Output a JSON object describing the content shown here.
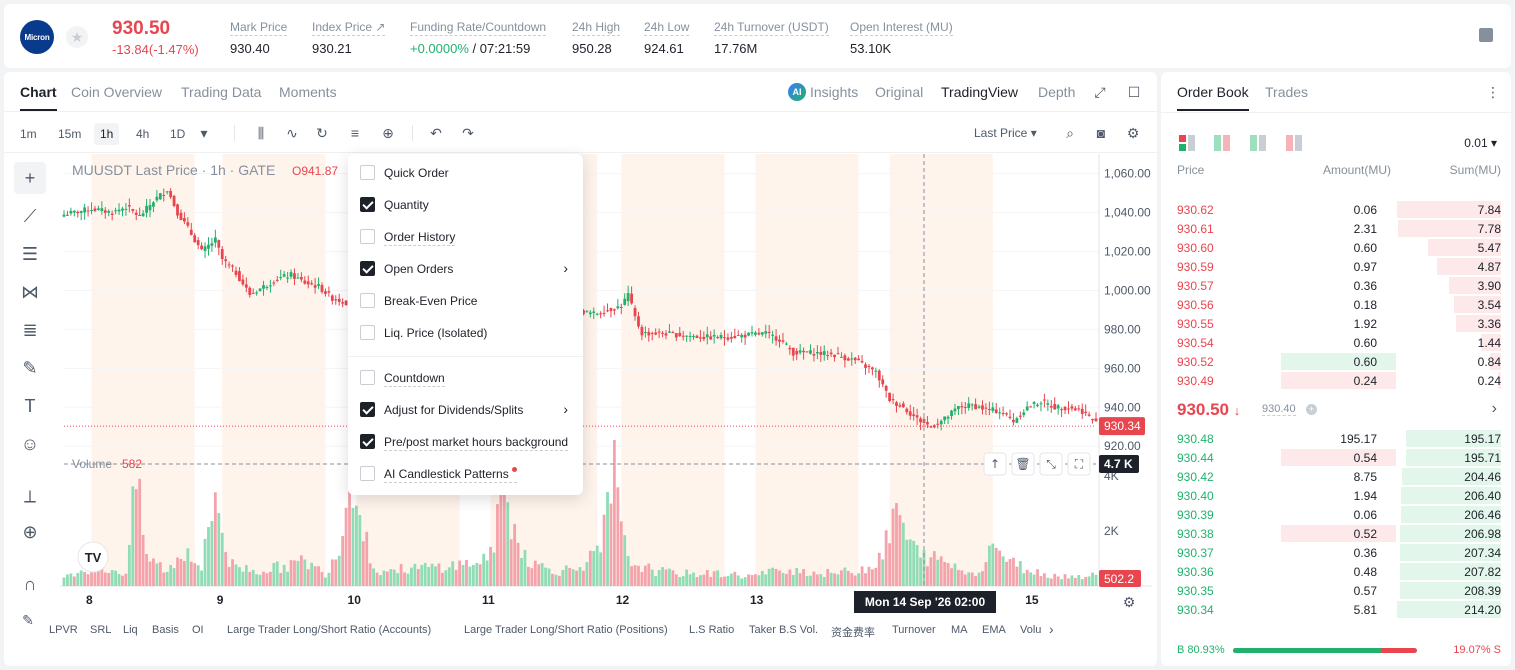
{
  "header": {
    "logo_text": "Micron",
    "last_price": "930.50",
    "change": "-13.84(-1.47%)",
    "stats": [
      {
        "label": "Mark Price",
        "value": "930.40"
      },
      {
        "label": "Index Price ↗",
        "value": "930.21"
      },
      {
        "label": "Funding Rate/Countdown",
        "value_green": "+0.0000%",
        "value": " / 07:21:59"
      },
      {
        "label": "24h High",
        "value": "950.28"
      },
      {
        "label": "24h Low",
        "value": "924.61"
      },
      {
        "label": "24h Turnover (USDT)",
        "value": "17.76M"
      },
      {
        "label": "Open Interest (MU)",
        "value": "53.10K"
      }
    ]
  },
  "chart_tabs": [
    "Chart",
    "Coin Overview",
    "Trading Data",
    "Moments"
  ],
  "view_tabs": {
    "ai_badge": "AI",
    "insights": "Insights",
    "original": "Original",
    "tradingview": "TradingView",
    "depth": "Depth"
  },
  "timeframes": [
    "1m",
    "15m",
    "1h",
    "4h",
    "1D"
  ],
  "price_source": "Last Price ▾",
  "chart_legend": {
    "symbol": "MUUSDT Last Price · 1h · GATE",
    "open": "O941.87",
    "volume_label": "Volume",
    "volume_value": "582"
  },
  "chart_data": {
    "type": "candlestick",
    "y_ticks": [
      "1,060.00",
      "1,040.00",
      "1,020.00",
      "1,000.00",
      "980.00",
      "960.00",
      "940.00",
      "920.00"
    ],
    "ylim": [
      916,
      1066
    ],
    "volume_ticks": [
      "4K",
      "2K"
    ],
    "volume_ylim": [
      0,
      4800
    ],
    "x_ticks": [
      "8",
      "9",
      "10",
      "11",
      "12",
      "13",
      "15"
    ],
    "last_price_tag": "930.34",
    "volume_tag": "502.2",
    "crosshair_volume": "4.7 K",
    "crosshair_time": "Mon 14 Sep '26   02:00",
    "close_anchors": [
      [
        0,
        1039
      ],
      [
        8,
        1042
      ],
      [
        14,
        1040
      ],
      [
        18,
        1043
      ],
      [
        22,
        1038
      ],
      [
        26,
        1046
      ],
      [
        30,
        1052
      ],
      [
        33,
        1040
      ],
      [
        36,
        1032
      ],
      [
        40,
        1020
      ],
      [
        44,
        1026
      ],
      [
        46,
        1016
      ],
      [
        50,
        1009
      ],
      [
        54,
        998
      ],
      [
        58,
        1002
      ],
      [
        62,
        1006
      ],
      [
        66,
        1008
      ],
      [
        70,
        1004
      ],
      [
        74,
        1002
      ],
      [
        78,
        996
      ],
      [
        82,
        994
      ],
      [
        85,
        1022
      ],
      [
        88,
        1044
      ],
      [
        92,
        1052
      ],
      [
        96,
        1058
      ],
      [
        100,
        1040
      ],
      [
        106,
        1030
      ],
      [
        112,
        1024
      ],
      [
        118,
        1016
      ],
      [
        124,
        1012
      ],
      [
        130,
        1008
      ],
      [
        136,
        1000
      ],
      [
        142,
        994
      ],
      [
        148,
        990
      ],
      [
        154,
        988
      ],
      [
        158,
        990
      ],
      [
        162,
        992
      ],
      [
        164,
        998
      ],
      [
        166,
        986
      ],
      [
        168,
        978
      ],
      [
        174,
        978
      ],
      [
        180,
        977
      ],
      [
        186,
        976
      ],
      [
        192,
        976
      ],
      [
        198,
        977
      ],
      [
        204,
        978
      ],
      [
        208,
        975
      ],
      [
        212,
        968
      ],
      [
        218,
        968
      ],
      [
        224,
        967
      ],
      [
        230,
        964
      ],
      [
        236,
        958
      ],
      [
        240,
        944
      ],
      [
        244,
        940
      ],
      [
        248,
        934
      ],
      [
        252,
        930
      ],
      [
        256,
        934
      ],
      [
        260,
        940
      ],
      [
        264,
        941
      ],
      [
        268,
        939
      ],
      [
        272,
        938
      ],
      [
        276,
        933
      ],
      [
        280,
        940
      ],
      [
        284,
        943
      ],
      [
        288,
        940
      ],
      [
        292,
        940
      ],
      [
        296,
        938
      ],
      [
        300,
        932
      ]
    ],
    "volume_anchors": [
      [
        0,
        500
      ],
      [
        8,
        700
      ],
      [
        14,
        650
      ],
      [
        18,
        520
      ],
      [
        21,
        4300
      ],
      [
        24,
        1200
      ],
      [
        30,
        600
      ],
      [
        36,
        1500
      ],
      [
        40,
        700
      ],
      [
        44,
        3800
      ],
      [
        48,
        900
      ],
      [
        56,
        600
      ],
      [
        64,
        800
      ],
      [
        70,
        1000
      ],
      [
        76,
        500
      ],
      [
        80,
        1600
      ],
      [
        84,
        4700
      ],
      [
        86,
        3200
      ],
      [
        90,
        600
      ],
      [
        100,
        700
      ],
      [
        110,
        800
      ],
      [
        118,
        900
      ],
      [
        124,
        1200
      ],
      [
        128,
        3900
      ],
      [
        130,
        2700
      ],
      [
        132,
        1800
      ],
      [
        136,
        900
      ],
      [
        144,
        600
      ],
      [
        150,
        800
      ],
      [
        156,
        1400
      ],
      [
        160,
        4700
      ],
      [
        162,
        2200
      ],
      [
        164,
        1000
      ],
      [
        172,
        600
      ],
      [
        180,
        500
      ],
      [
        190,
        500
      ],
      [
        200,
        400
      ],
      [
        210,
        700
      ],
      [
        220,
        500
      ],
      [
        230,
        600
      ],
      [
        236,
        900
      ],
      [
        240,
        2000
      ],
      [
        242,
        3200
      ],
      [
        246,
        1600
      ],
      [
        250,
        1200
      ],
      [
        256,
        1000
      ],
      [
        260,
        700
      ],
      [
        264,
        500
      ],
      [
        268,
        900
      ],
      [
        270,
        2000
      ],
      [
        274,
        1000
      ],
      [
        280,
        700
      ],
      [
        284,
        500
      ],
      [
        290,
        400
      ],
      [
        296,
        400
      ],
      [
        300,
        500
      ]
    ],
    "session_bands": [
      [
        8,
        38
      ],
      [
        46,
        76
      ],
      [
        85,
        115
      ],
      [
        124,
        155
      ],
      [
        162,
        192
      ],
      [
        201,
        231
      ],
      [
        240,
        270
      ]
    ],
    "crosshair_index": 250
  },
  "bottom_tabs": [
    "LPVR",
    "SRL",
    "Liq",
    "Basis",
    "OI",
    "Large Trader Long/Short Ratio (Accounts)",
    "Large Trader Long/Short Ratio (Positions)",
    "L.S Ratio",
    "Taker B.S Vol.",
    "资金费率",
    "Turnover",
    "MA",
    "EMA",
    "Volu"
  ],
  "dropdown": {
    "items": [
      {
        "label": "Quick Order",
        "checked": false
      },
      {
        "label": "Quantity",
        "checked": true
      },
      {
        "label": "Order History",
        "checked": false
      },
      {
        "label": "Open Orders",
        "checked": true,
        "submenu": true
      },
      {
        "label": "Break-Even Price",
        "checked": false
      },
      {
        "label": "Liq. Price (Isolated)",
        "checked": false
      },
      {
        "label": "Countdown",
        "checked": false
      },
      {
        "label": "Adjust for Dividends/Splits",
        "checked": true,
        "submenu": true
      },
      {
        "label": "Pre/post market hours background",
        "checked": true
      },
      {
        "label": "AI Candlestick Patterns",
        "checked": false,
        "dot": true
      }
    ]
  },
  "orderbook": {
    "tabs": [
      "Order Book",
      "Trades"
    ],
    "precision": "0.01 ▾",
    "headers": {
      "price": "Price",
      "amount": "Amount(MU)",
      "sum": "Sum(MU)"
    },
    "asks": [
      {
        "price": "930.62",
        "amount": "0.06",
        "sum": "7.84",
        "depth": 1.0,
        "amt_depth": 0
      },
      {
        "price": "930.61",
        "amount": "2.31",
        "sum": "7.78",
        "depth": 0.99,
        "amt_depth": 0
      },
      {
        "price": "930.60",
        "amount": "0.60",
        "sum": "5.47",
        "depth": 0.7,
        "amt_depth": 0
      },
      {
        "price": "930.59",
        "amount": "0.97",
        "sum": "4.87",
        "depth": 0.62,
        "amt_depth": 0
      },
      {
        "price": "930.57",
        "amount": "0.36",
        "sum": "3.90",
        "depth": 0.5,
        "amt_depth": 0
      },
      {
        "price": "930.56",
        "amount": "0.18",
        "sum": "3.54",
        "depth": 0.45,
        "amt_depth": 0
      },
      {
        "price": "930.55",
        "amount": "1.92",
        "sum": "3.36",
        "depth": 0.43,
        "amt_depth": 0
      },
      {
        "price": "930.54",
        "amount": "0.60",
        "sum": "1.44",
        "depth": 0.19,
        "amt_depth": 0
      },
      {
        "price": "930.52",
        "amount": "0.60",
        "sum": "0.84",
        "depth": 0.11,
        "amt_depth": 0.36,
        "amt_green": true
      },
      {
        "price": "930.49",
        "amount": "0.24",
        "sum": "0.24",
        "depth": 0.03,
        "amt_depth": 0.36
      }
    ],
    "last_price": "930.50",
    "mark_price": "930.40",
    "bids": [
      {
        "price": "930.48",
        "amount": "195.17",
        "sum": "195.17",
        "depth": 0.91,
        "amt_depth": 0
      },
      {
        "price": "930.44",
        "amount": "0.54",
        "sum": "195.71",
        "depth": 0.91,
        "amt_depth": 0.36,
        "amt_red": true
      },
      {
        "price": "930.42",
        "amount": "8.75",
        "sum": "204.46",
        "depth": 0.95,
        "amt_depth": 0
      },
      {
        "price": "930.40",
        "amount": "1.94",
        "sum": "206.40",
        "depth": 0.96,
        "amt_depth": 0
      },
      {
        "price": "930.39",
        "amount": "0.06",
        "sum": "206.46",
        "depth": 0.96,
        "amt_depth": 0
      },
      {
        "price": "930.38",
        "amount": "0.52",
        "sum": "206.98",
        "depth": 0.97,
        "amt_depth": 0.36,
        "amt_red": true
      },
      {
        "price": "930.37",
        "amount": "0.36",
        "sum": "207.34",
        "depth": 0.97,
        "amt_depth": 0
      },
      {
        "price": "930.36",
        "amount": "0.48",
        "sum": "207.82",
        "depth": 0.97,
        "amt_depth": 0
      },
      {
        "price": "930.35",
        "amount": "0.57",
        "sum": "208.39",
        "depth": 0.97,
        "amt_depth": 0
      },
      {
        "price": "930.34",
        "amount": "5.81",
        "sum": "214.20",
        "depth": 1.0,
        "amt_depth": 0
      }
    ],
    "buy_ratio": "B 80.93%",
    "sell_ratio": "19.07% S",
    "buy_fraction": 0.8093
  },
  "colors": {
    "green": "#20b26c",
    "red": "#e8464f",
    "session": "#fff4ec"
  }
}
